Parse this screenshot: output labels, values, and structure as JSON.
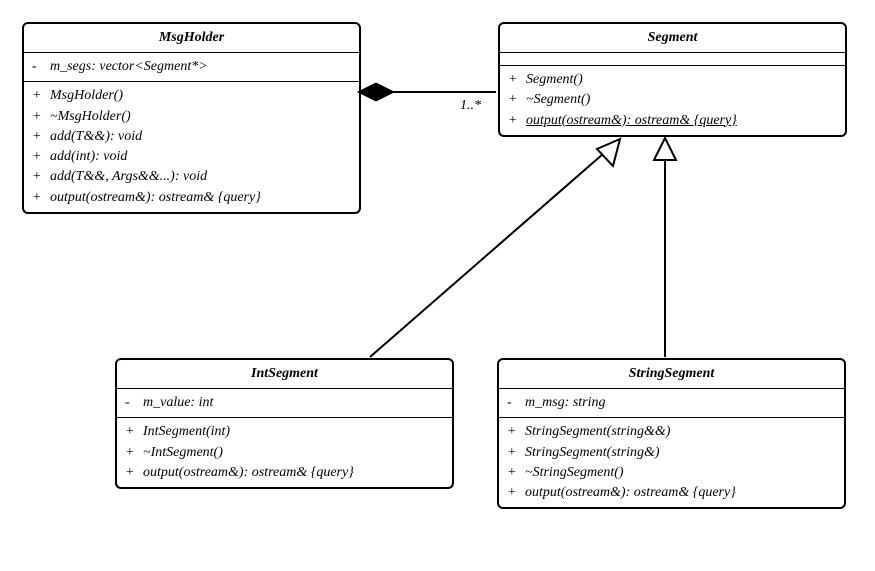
{
  "diagram_type": "UML Class Diagram",
  "classes": {
    "msgholder": {
      "name": "MsgHolder",
      "attributes": [
        {
          "vis": "-",
          "sig": "m_segs: vector<Segment*>"
        }
      ],
      "operations": [
        {
          "vis": "+",
          "sig": "MsgHolder()"
        },
        {
          "vis": "+",
          "sig": "~MsgHolder()"
        },
        {
          "vis": "+",
          "sig": "add(T&&): void"
        },
        {
          "vis": "+",
          "sig": "add(int): void"
        },
        {
          "vis": "+",
          "sig": "add(T&&, Args&&...): void"
        },
        {
          "vis": "+",
          "sig": "output(ostream&): ostream& {query}"
        }
      ]
    },
    "segment": {
      "name": "Segment",
      "attributes": [],
      "operations": [
        {
          "vis": "+",
          "sig": "Segment()"
        },
        {
          "vis": "+",
          "sig": "~Segment()"
        },
        {
          "vis": "+",
          "sig": "output(ostream&): ostream& {query}",
          "underline": true
        }
      ]
    },
    "intsegment": {
      "name": "IntSegment",
      "attributes": [
        {
          "vis": "-",
          "sig": "m_value: int"
        }
      ],
      "operations": [
        {
          "vis": "+",
          "sig": "IntSegment(int)"
        },
        {
          "vis": "+",
          "sig": "~IntSegment()"
        },
        {
          "vis": "+",
          "sig": "output(ostream&): ostream& {query}"
        }
      ]
    },
    "stringsegment": {
      "name": "StringSegment",
      "attributes": [
        {
          "vis": "-",
          "sig": "m_msg: string"
        }
      ],
      "operations": [
        {
          "vis": "+",
          "sig": "StringSegment(string&&)"
        },
        {
          "vis": "+",
          "sig": "StringSegment(string&)"
        },
        {
          "vis": "+",
          "sig": "~StringSegment()"
        },
        {
          "vis": "+",
          "sig": "output(ostream&): ostream& {query}"
        }
      ]
    }
  },
  "relationships": [
    {
      "from": "MsgHolder",
      "to": "Segment",
      "type": "composition",
      "multiplicity_to": "1..*"
    },
    {
      "from": "IntSegment",
      "to": "Segment",
      "type": "generalization"
    },
    {
      "from": "StringSegment",
      "to": "Segment",
      "type": "generalization"
    }
  ],
  "multiplicity_label": "1..*"
}
